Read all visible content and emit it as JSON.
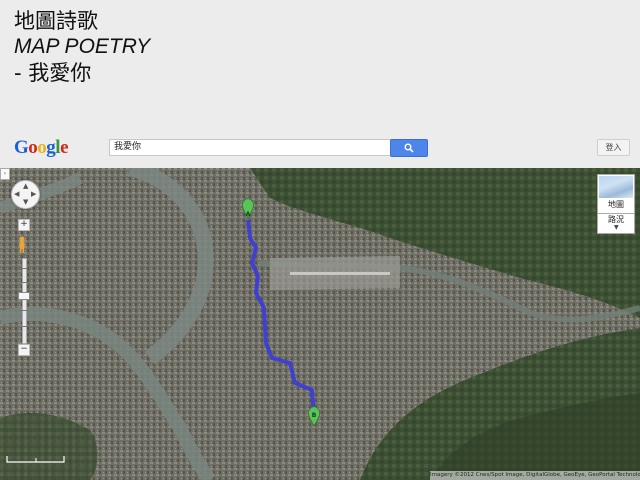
{
  "title": {
    "line1": "地圖詩歌",
    "line2": "MAP POETRY",
    "line3": "- 我愛你"
  },
  "google_bar": {
    "logo": {
      "G": "G",
      "o1": "o",
      "o2": "o",
      "g": "g",
      "l": "l",
      "e": "e"
    },
    "search_value": "我愛你",
    "search_icon": "magnifier-icon",
    "signin_label": "登入"
  },
  "map": {
    "controls": {
      "nav_ring_icon": "pan-control-icon",
      "pegman_icon": "pegman-icon",
      "zoom_in": "+",
      "zoom_out": "−"
    },
    "map_type_label": "地圖",
    "traffic_label": "路況",
    "markers": [
      {
        "label": "A"
      },
      {
        "label": "B"
      }
    ],
    "attribution": "Imagery ©2012 Cnes/Spot Image, DigitalGlobe, GeoEye, GeoPortal Technologies",
    "route_color": "#3b3bdc",
    "marker_color": "#5cc25a"
  }
}
